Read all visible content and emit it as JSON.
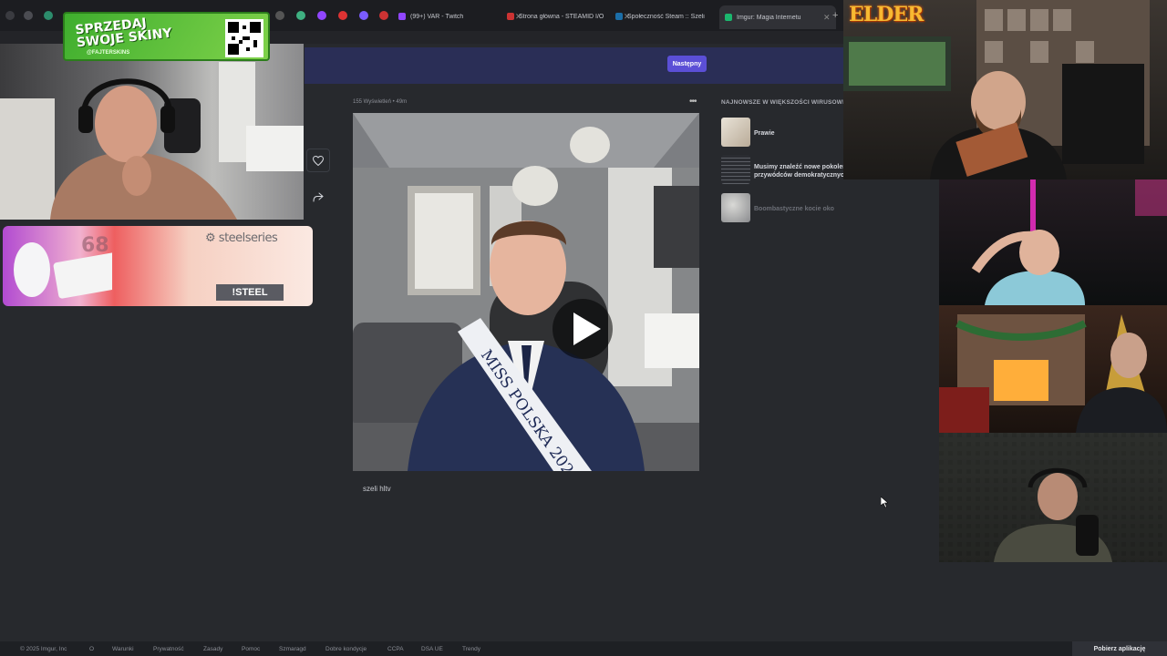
{
  "browser": {
    "tabs": [
      {
        "label": "(99+) VAR - Twitch",
        "color": "#9146ff"
      },
      {
        "label": "Strona główna - STEAMID I/O",
        "color": "#c33"
      },
      {
        "label": "Społeczność Steam :: Szeli",
        "color": "#1b6ea8"
      },
      {
        "label": "Imgur: Magia Internetu",
        "color": "#1bb76e",
        "active": true
      }
    ],
    "new_tab": "+"
  },
  "imgur": {
    "next_button": "Następny",
    "post": {
      "meta": "155 Wyświetleń • 49m",
      "menu": "•••",
      "description": "szeli hltv",
      "sash_text": "MISS POLSKA 202"
    },
    "viral": {
      "title": "NAJNOWSZE W WIĘKSZOŚCI WIRUSOWE",
      "items": [
        {
          "title": "Prawie",
          "dim": false
        },
        {
          "title": "Musimy znaleźć nowe pokolenie przywódców demokratycznych",
          "line1": "Musimy znaleźć nowe pokolen",
          "line2": "przywódców demokratycznych",
          "dim": false
        },
        {
          "title": "Boombastyczne kocie oko",
          "dim": true
        }
      ]
    },
    "footer": {
      "links": [
        "© 2025 Imgur, Inc",
        "O",
        "Warunki",
        "Prywatność",
        "Zasady",
        "Pomoc",
        "Szmaragd",
        "Dobre kondycje",
        "CCPA",
        "DSA UE",
        "Trendy"
      ],
      "app_button": "Pobierz aplikację"
    }
  },
  "overlays": {
    "promo": {
      "line1": "SPRZEDAJ",
      "line2": "SWOJE SKINY",
      "handle": "@FAJTERSKINS"
    },
    "steelseries": {
      "brand": "steelseries",
      "command": "!STEEL",
      "model": "68"
    },
    "elder": {
      "logo": "ELDER"
    }
  }
}
